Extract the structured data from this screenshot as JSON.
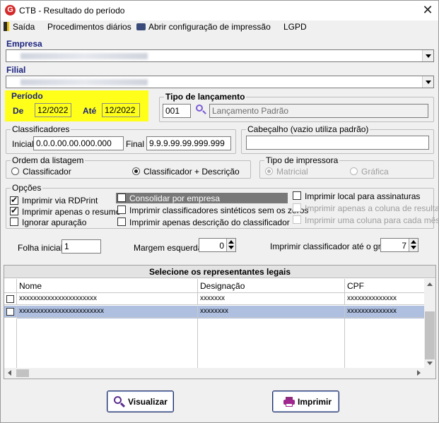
{
  "window": {
    "title": "CTB - Resultado do período"
  },
  "menu": {
    "exit": "Saída",
    "daily": "Procedimentos diários",
    "print_config": "Abrir configuração de impressão",
    "lgpd": "LGPD"
  },
  "empresa": {
    "label": "Empresa"
  },
  "filial": {
    "label": "Filial"
  },
  "periodo": {
    "title": "Período",
    "de_label": "De",
    "de_value": "12/2022",
    "ate_label": "Até",
    "ate_value": "12/2022"
  },
  "tipo_lancamento": {
    "title": "Tipo de lançamento",
    "code": "001",
    "description": "Lançamento Padrão"
  },
  "classificadores": {
    "title": "Classificadores",
    "inicial_label": "Inicial",
    "inicial_value": "0.0.0.00.00.000.000",
    "final_label": "Final",
    "final_value": "9.9.9.99.99.999.999"
  },
  "cabecalho": {
    "title": "Cabeçalho (vazio utiliza padrão)",
    "value": ""
  },
  "ordem": {
    "title": "Ordem da listagem",
    "options": [
      "Classificador",
      "Classificador + Descrição"
    ],
    "selected": 1
  },
  "impressora": {
    "title": "Tipo de impressora",
    "options": [
      "Matricial",
      "Gráfica"
    ],
    "selected": 0
  },
  "opcoes": {
    "title": "Opções",
    "col1": [
      {
        "label": "Imprimir via RDPrint",
        "checked": true
      },
      {
        "label": "Imprimir apenas o resumo",
        "checked": true
      },
      {
        "label": "Ignorar apuração",
        "checked": false
      }
    ],
    "col2": [
      {
        "label": "Consolidar por empresa",
        "checked": false,
        "highlight": true
      },
      {
        "label": "Imprimir classificadores sintéticos sem os zeros",
        "checked": false
      },
      {
        "label": "Imprimir apenas descrição do classificador",
        "checked": false
      }
    ],
    "col3": [
      {
        "label": "Imprimir local para assinaturas",
        "checked": false,
        "disabled": false
      },
      {
        "label": "Imprimir apenas a coluna de resultado",
        "checked": false,
        "disabled": true
      },
      {
        "label": "Imprimir uma coluna para cada mês",
        "checked": false,
        "disabled": true
      }
    ]
  },
  "params": {
    "folha_label": "Folha inicial",
    "folha_value": "1",
    "margem_label": "Margem esquerda",
    "margem_value": "0",
    "grau_label": "Imprimir classificador até o grau",
    "grau_value": "7"
  },
  "representantes": {
    "title": "Selecione os representantes legais",
    "columns": [
      "Nome",
      "Designação",
      "CPF"
    ],
    "rows": [
      {
        "nome": "xxxxxxxxxxxxxxxxxxxxxx",
        "designacao": "xxxxxxx",
        "cpf": "xxxxxxxxxxxxxx",
        "checked": false,
        "selected": false
      },
      {
        "nome": "xxxxxxxxxxxxxxxxxxxxxxxx",
        "designacao": "xxxxxxxx",
        "cpf": "xxxxxxxxxxxxxx",
        "checked": false,
        "selected": true
      }
    ]
  },
  "buttons": {
    "visualizar": "Visualizar",
    "imprimir": "Imprimir"
  },
  "colors": {
    "highlight": "#ffff1a",
    "selected_row": "#aebfe0",
    "accent_blue": "#1a237e",
    "app_red": "#d42a2a"
  }
}
